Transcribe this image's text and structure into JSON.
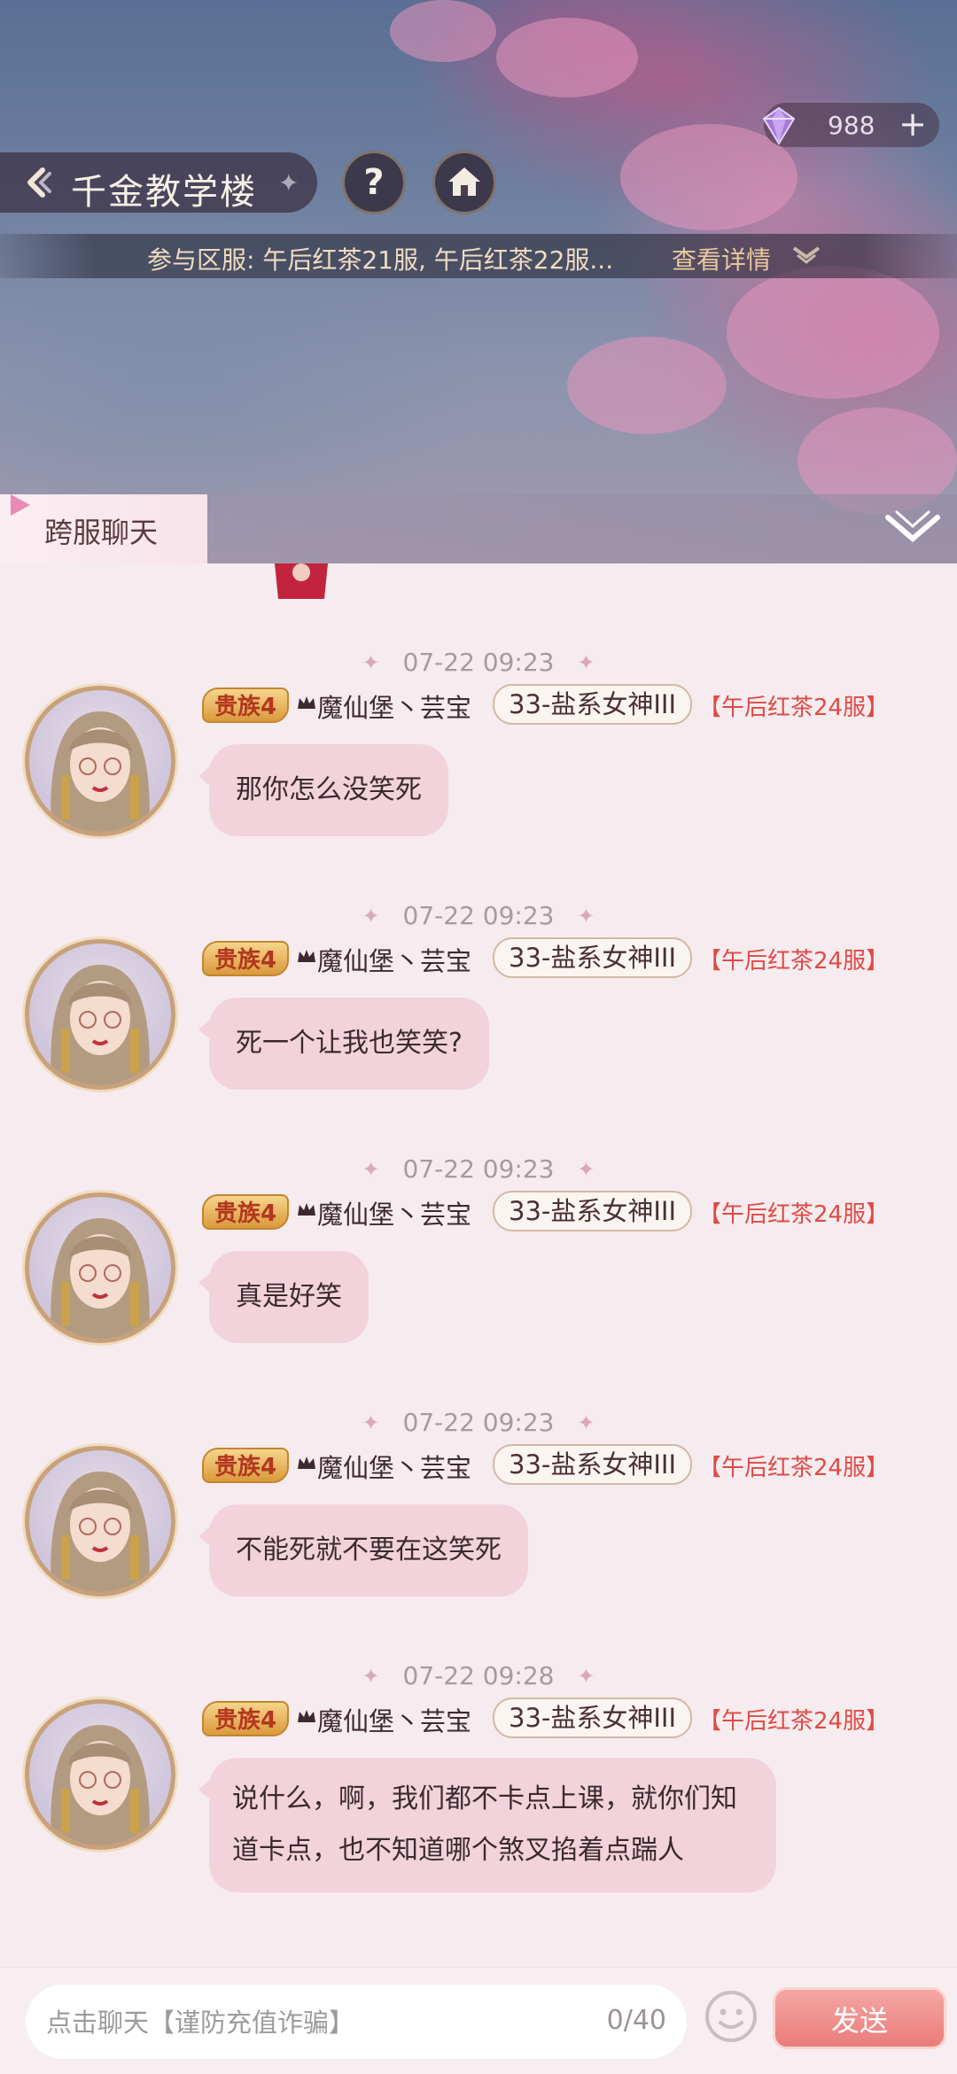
{
  "header": {
    "title": "千金教学楼",
    "currency_value": "988",
    "currency_plus": "+",
    "help_label": "?",
    "servers_text": "参与区服: 午后红茶21服, 午后红茶22服...",
    "details_label": "查看详情"
  },
  "chat": {
    "tab_label": "跨服聊天",
    "messages": [
      {
        "time": "07-22 09:23",
        "rank": "贵族4",
        "name": "魔仙堡丶芸宝",
        "title": "33-盐系女神III",
        "server": "【午后红茶24服】",
        "text": "那你怎么没笑死"
      },
      {
        "time": "07-22 09:23",
        "rank": "贵族4",
        "name": "魔仙堡丶芸宝",
        "title": "33-盐系女神III",
        "server": "【午后红茶24服】",
        "text": "死一个让我也笑笑?"
      },
      {
        "time": "07-22 09:23",
        "rank": "贵族4",
        "name": "魔仙堡丶芸宝",
        "title": "33-盐系女神III",
        "server": "【午后红茶24服】",
        "text": "真是好笑"
      },
      {
        "time": "07-22 09:23",
        "rank": "贵族4",
        "name": "魔仙堡丶芸宝",
        "title": "33-盐系女神III",
        "server": "【午后红茶24服】",
        "text": "不能死就不要在这笑死"
      },
      {
        "time": "07-22 09:28",
        "rank": "贵族4",
        "name": "魔仙堡丶芸宝",
        "title": "33-盐系女神III",
        "server": "【午后红茶24服】",
        "text": "说什么，啊，我们都不卡点上课，就你们知道卡点，也不知道哪个煞叉掐着点踹人"
      }
    ]
  },
  "input": {
    "placeholder": "点击聊天【谨防充值诈骗】",
    "value": "",
    "counter": "0/40",
    "send_label": "发送"
  },
  "colors": {
    "bubble": "#f2d3db",
    "server_tag": "#e04a45",
    "send_button": "#e97c7b"
  },
  "icons": [
    "gem-icon",
    "back-icon",
    "help-icon",
    "home-icon",
    "chevron-down-icon",
    "collapse-icon",
    "crown-icon",
    "emoji-icon"
  ]
}
